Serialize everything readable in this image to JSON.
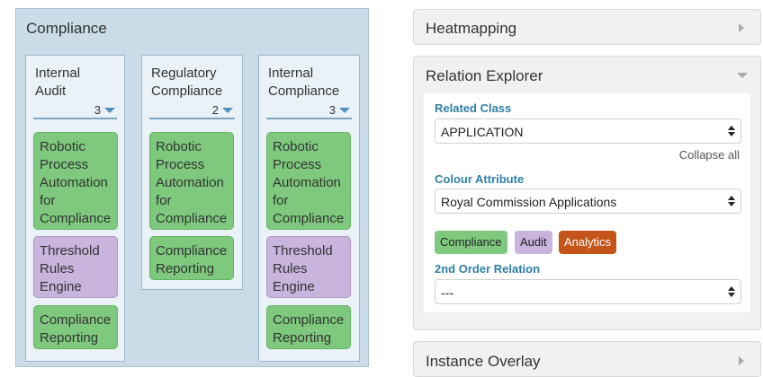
{
  "board": {
    "title": "Compliance",
    "columns": [
      {
        "title": "Internal Audit",
        "count": "3",
        "cards": [
          {
            "label": "Robotic Process Automation for Compliance",
            "category": "Compliance"
          },
          {
            "label": "Threshold Rules Engine",
            "category": "Audit"
          },
          {
            "label": "Compliance Reporting",
            "category": "Compliance"
          }
        ]
      },
      {
        "title": "Regulatory Compliance",
        "count": "2",
        "cards": [
          {
            "label": "Robotic Process Automation for Compliance",
            "category": "Compliance"
          },
          {
            "label": "Compliance Reporting",
            "category": "Compliance"
          }
        ]
      },
      {
        "title": "Internal Compliance",
        "count": "3",
        "cards": [
          {
            "label": "Robotic Process Automation for Compliance",
            "category": "Compliance"
          },
          {
            "label": "Threshold Rules Engine",
            "category": "Audit"
          },
          {
            "label": "Compliance Reporting",
            "category": "Compliance"
          }
        ]
      }
    ]
  },
  "panels": {
    "heatmapping": {
      "title": "Heatmapping",
      "expanded": false
    },
    "relation_explorer": {
      "title": "Relation Explorer",
      "expanded": true,
      "related_class_label": "Related Class",
      "related_class_value": "APPLICATION",
      "collapse_all": "Collapse all",
      "colour_attribute_label": "Colour Attribute",
      "colour_attribute_value": "Royal Commission Applications",
      "legend": [
        {
          "label": "Compliance",
          "color": "#7ec97e",
          "text_color": "#222222"
        },
        {
          "label": "Audit",
          "color": "#c8b4dc",
          "text_color": "#222222"
        },
        {
          "label": "Analytics",
          "color": "#c4541a",
          "text_color": "#ffffff"
        }
      ],
      "second_order_label": "2nd Order Relation",
      "second_order_value": "---"
    },
    "instance_overlay": {
      "title": "Instance Overlay",
      "expanded": false
    }
  },
  "colors": {
    "compliance": "#7ec97e",
    "audit": "#c8b4dc",
    "analytics": "#c4541a",
    "label_blue": "#2f7fa6"
  },
  "icons": [
    "chevron-down-icon",
    "triangle-right-icon",
    "triangle-down-icon",
    "select-arrows-icon"
  ]
}
